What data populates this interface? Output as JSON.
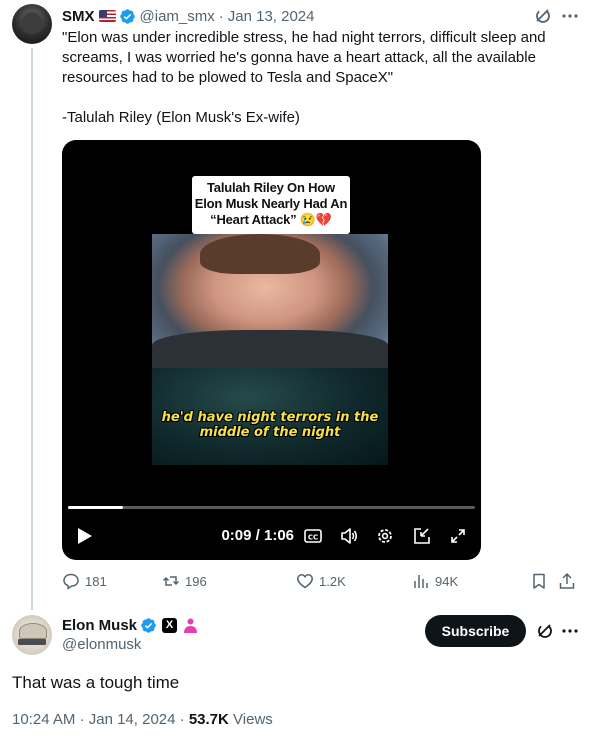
{
  "tweet1": {
    "name": "SMX",
    "handle": "@iam_smx",
    "date": "Jan 13, 2024",
    "text": "\"Elon was under incredible stress, he had night terrors, difficult sleep and screams, I was worried he's gonna have a heart attack, all the available resources had to be plowed to Tesla and SpaceX\"\n\n-Talulah Riley (Elon Musk's Ex-wife)",
    "media": {
      "caption": "Talulah Riley On How Elon Musk Nearly Had An “Heart Attack” 😢💔",
      "subtitle": "he'd have night terrors in the middle of the night",
      "time": "0:09 / 1:06",
      "progress": 0.136
    },
    "actions": {
      "replies": "181",
      "reposts": "196",
      "likes": "1.2K",
      "views": "94K"
    }
  },
  "tweet2": {
    "name": "Elon Musk",
    "handle": "@elonmusk",
    "subscribe_label": "Subscribe",
    "text": "That was a tough time",
    "time": "10:24 AM",
    "date": "Jan 14, 2024",
    "views_count": "53.7K",
    "views_label": "Views"
  },
  "colors": {
    "verified": "#1d9bf0",
    "text": "#0f1419",
    "muted": "#536471",
    "affiliate": "#e040b0"
  }
}
